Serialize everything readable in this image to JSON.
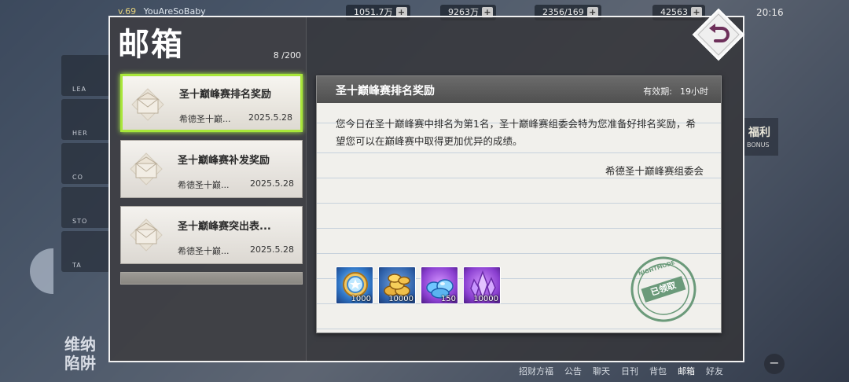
{
  "topbar": {
    "level": "v.69",
    "username": "YouAreSoBaby",
    "resources": [
      {
        "value": "1051.7万"
      },
      {
        "value": "9263万"
      },
      {
        "value": "2356/169"
      },
      {
        "value": "42563"
      }
    ],
    "clock": "20:16"
  },
  "background": {
    "left_menu": [
      "LEA",
      "HER",
      "CO",
      "STO",
      "TA"
    ],
    "bottom_left_title": "维纳",
    "bottom_left_subtitle": "陷阱",
    "right_badge": "福利",
    "right_badge_sub": "BONUS",
    "bottom_nav": [
      "招财方福",
      "公告",
      "聊天",
      "日刊",
      "背包",
      "邮箱",
      "好友"
    ],
    "bottom_nav_active": "邮箱"
  },
  "mailbox": {
    "title": "邮箱",
    "count": "8 /200",
    "items": [
      {
        "subject": "圣十巅峰赛排名奖励",
        "sender": "希德圣十巅...",
        "date": "2025.5.28"
      },
      {
        "subject": "圣十巅峰赛补发奖励",
        "sender": "希德圣十巅...",
        "date": "2025.5.28"
      },
      {
        "subject": "圣十巅峰赛突出表...",
        "sender": "希德圣十巅...",
        "date": "2025.5.28"
      }
    ]
  },
  "letter": {
    "subject": "圣十巅峰赛排名奖励",
    "expiry_label": "有效期:",
    "expiry_value": "19小时",
    "body": "您今日在圣十巅峰赛中排名为第1名，圣十巅峰赛组委会特为您准备好排名奖励，希望您可以在巅峰赛中取得更加优异的成绩。",
    "signature": "希德圣十巅峰赛组委会",
    "rewards": [
      {
        "icon": "medal-icon",
        "qty": "1000"
      },
      {
        "icon": "gold-coins-icon",
        "qty": "10000"
      },
      {
        "icon": "blue-gems-icon",
        "qty": "150"
      },
      {
        "icon": "purple-crystal-icon",
        "qty": "10000"
      }
    ],
    "stamp_label": "已领取",
    "stamp_ring_text": "NIGHTMODE"
  },
  "colors": {
    "selected_border": "#a8e63a",
    "window_border": "#f2f2f2",
    "stamp": "#6b9a7a"
  }
}
